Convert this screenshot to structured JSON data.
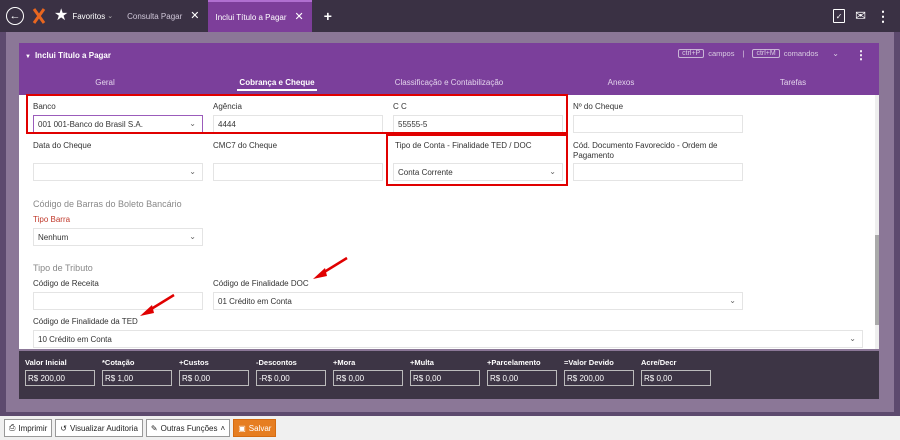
{
  "topbar": {
    "favorites_label": "Favoritos",
    "tabs": [
      {
        "label": "Consulta Pagar"
      },
      {
        "label": "Inclui Título a Pagar"
      }
    ]
  },
  "panel": {
    "title": "Inclui Título a Pagar",
    "shortcut_fields_key": "ctrl+P",
    "shortcut_fields_label": "campos",
    "shortcut_separator": "|",
    "shortcut_commands_key": "ctrl+M",
    "shortcut_commands_label": "comandos",
    "tabs": [
      "Geral",
      "Cobrança e Cheque",
      "Classificação e Contabilização",
      "Anexos",
      "Tarefas"
    ]
  },
  "form": {
    "banco": {
      "label": "Banco",
      "value": "001 001-Banco do Brasil S.A."
    },
    "agencia": {
      "label": "Agência",
      "value": "4444"
    },
    "cc": {
      "label": "C C",
      "value": "55555-5"
    },
    "num_cheque": {
      "label": "Nº do Cheque",
      "value": ""
    },
    "data_cheque": {
      "label": "Data do Cheque",
      "value": ""
    },
    "cmc7": {
      "label": "CMC7 do Cheque",
      "value": ""
    },
    "tipo_conta": {
      "label": "Tipo de Conta - Finalidade TED / DOC",
      "value": "Conta Corrente"
    },
    "cod_documento": {
      "label_line1": "Cód. Documento Favorecido - Ordem de",
      "label_line2": "Pagamento",
      "value": ""
    },
    "section_boleto": "Código de Barras do Boleto Bancário",
    "tipo_barra": {
      "label": "Tipo Barra",
      "value": "Nenhum"
    },
    "section_tributo": "Tipo de Tributo",
    "cod_receita": {
      "label": "Código de Receita",
      "value": ""
    },
    "cod_finalidade_doc": {
      "label": "Código de Finalidade DOC",
      "value": "01 Crédito em Conta"
    },
    "cod_finalidade_ted": {
      "label": "Código de Finalidade da TED",
      "value": "10 Crédito em Conta"
    }
  },
  "totals": [
    {
      "label": "Valor Inicial",
      "value": "R$ 200,00"
    },
    {
      "label": "*Cotação",
      "value": "R$ 1,00"
    },
    {
      "label": "+Custos",
      "value": "R$ 0,00"
    },
    {
      "label": "-Descontos",
      "value": "-R$ 0,00"
    },
    {
      "label": "+Mora",
      "value": "R$ 0,00"
    },
    {
      "label": "+Multa",
      "value": "R$ 0,00"
    },
    {
      "label": "+Parcelamento",
      "value": "R$ 0,00"
    },
    {
      "label": "=Valor Devido",
      "value": "R$ 200,00"
    },
    {
      "label": "Acre/Decr",
      "value": "R$ 0,00"
    }
  ],
  "bottombar": {
    "print": "Imprimir",
    "audit": "Visualizar Auditoria",
    "other": "Outras Funções",
    "save": "Salvar"
  },
  "colors": {
    "accent": "#7b3f9b",
    "highlight": "#e00000",
    "save": "#e67e22"
  }
}
